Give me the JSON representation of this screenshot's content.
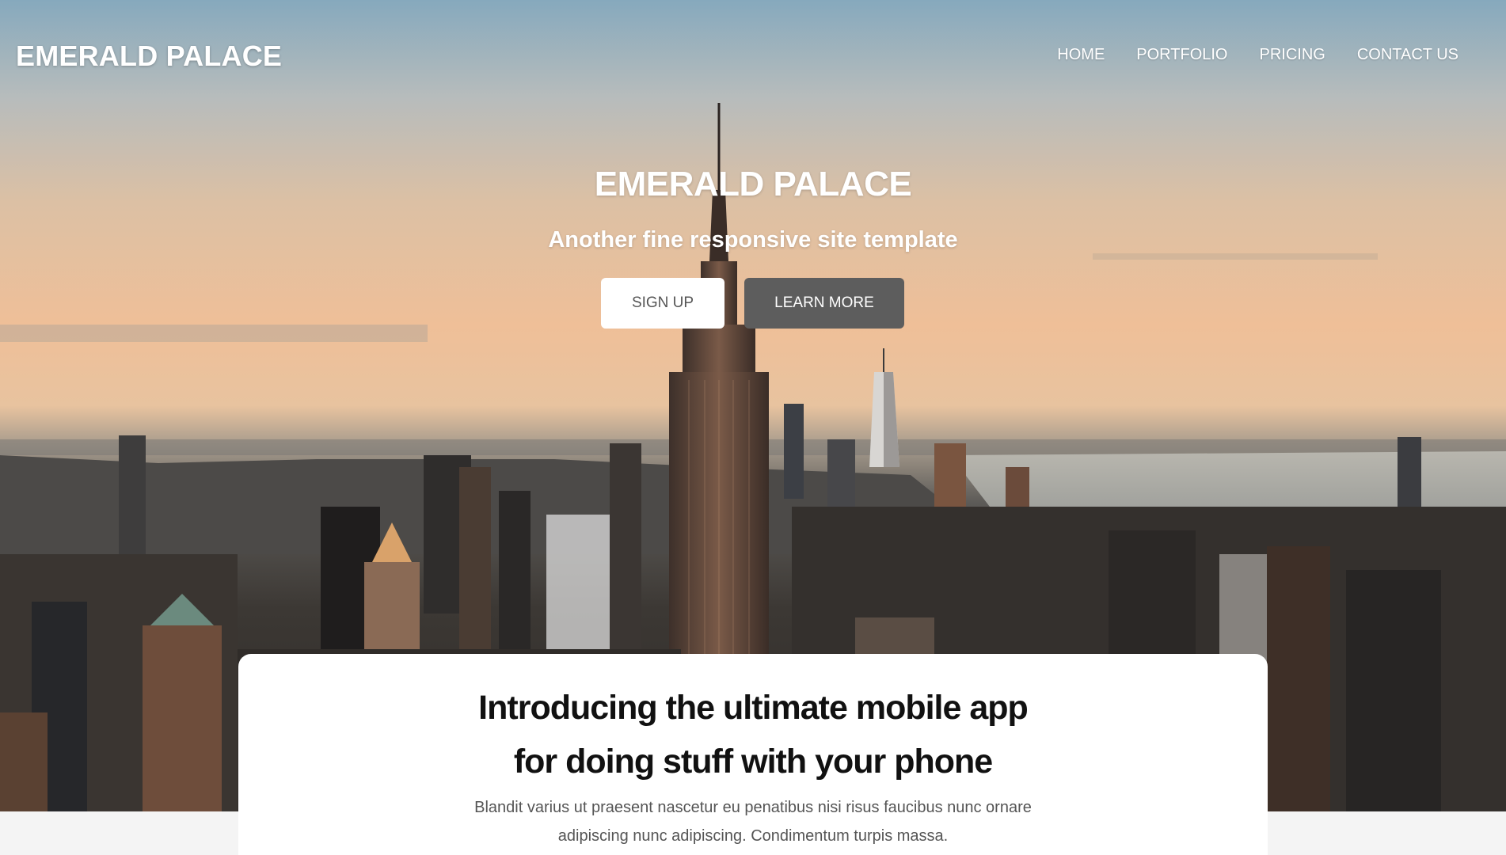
{
  "header": {
    "brand": "EMERALD PALACE",
    "nav": [
      "HOME",
      "PORTFOLIO",
      "PRICING",
      "CONTACT US"
    ]
  },
  "hero": {
    "title": "EMERALD PALACE",
    "subtitle": "Another fine responsive site template",
    "signup_label": "SIGN UP",
    "learn_label": "LEARN MORE"
  },
  "intro": {
    "title_line1": "Introducing the ultimate mobile app",
    "title_line2": "for doing stuff with your phone",
    "text": "Blandit varius ut praesent nascetur eu penatibus nisi risus faucibus nunc ornare adipiscing nunc adipiscing. Condimentum turpis massa."
  },
  "colors": {
    "button_dark": "#5d5d5d",
    "card_bg": "#ffffff",
    "page_bg": "#f4f4f4"
  }
}
